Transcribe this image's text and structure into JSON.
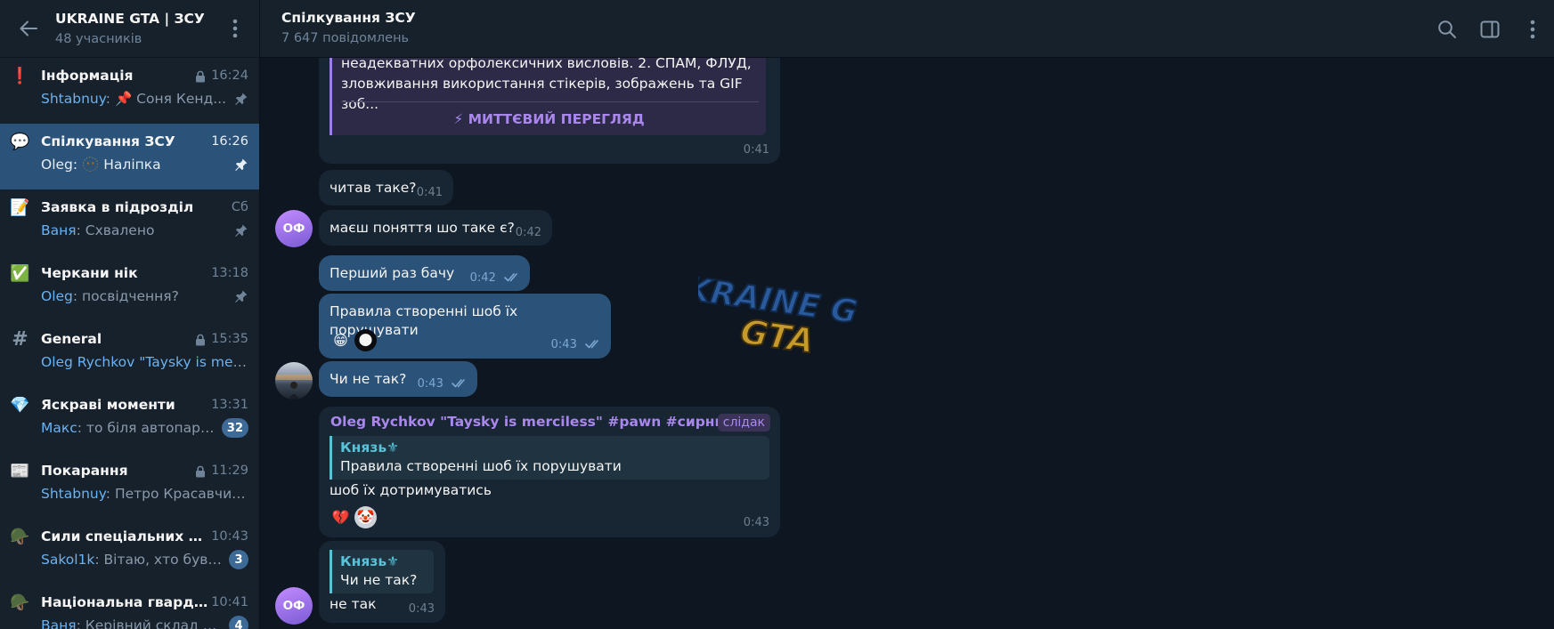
{
  "group": {
    "title": "UKRAINE GTA | ЗСУ",
    "members": "48 учасників"
  },
  "icons": {
    "back": "arrow-left-icon",
    "menu": "more-vertical-icon",
    "search": "search-icon",
    "sidebar_toggle": "side-panel-icon",
    "more": "more-vertical-icon",
    "lock": "lock-icon",
    "pin": "pin-icon",
    "read": "double-check-icon",
    "instant_view": "lightning-icon"
  },
  "colors": {
    "accent": "#2b5278",
    "link": "#6ab2f2",
    "badge": "#3e6a97",
    "forward_name": "#a987ec",
    "quote": "#58c2d9"
  },
  "topics": [
    {
      "icon": "❗",
      "name": "Інформація",
      "locked": true,
      "time": "16:24",
      "sender": "Shtabnuy",
      "preview": " 📌 Соня Кенд...",
      "pinned": true,
      "badge": "",
      "active": false
    },
    {
      "icon": "💬",
      "name": "Спілкування ЗСУ",
      "locked": false,
      "time": "16:26",
      "sender": "Oleg",
      "preview": " 🫥 Наліпка",
      "pinned": true,
      "badge": "",
      "active": true
    },
    {
      "icon": "📝",
      "name": "Заявка в підрозділ",
      "locked": false,
      "time": "Сб",
      "sender": "Ваня",
      "preview": " Схвалено",
      "pinned": true,
      "badge": "",
      "active": false
    },
    {
      "icon": "✅",
      "name": "Черкани нік",
      "locked": false,
      "time": "13:18",
      "sender": "Oleg",
      "preview": " посвідчення?",
      "pinned": true,
      "badge": "",
      "active": false
    },
    {
      "icon": "#",
      "name": "General",
      "locked": true,
      "time": "15:35",
      "sender": "Oleg Rychkov \"Taysky is merci...",
      "preview": "",
      "pinned": false,
      "badge": "",
      "active": false
    },
    {
      "icon": "💎",
      "name": "Яскраві моменти",
      "locked": false,
      "time": "13:31",
      "sender": "Макс",
      "preview": " то біля автопарку",
      "pinned": false,
      "badge": "32",
      "active": false
    },
    {
      "icon": "📰",
      "name": "Покарання",
      "locked": true,
      "time": "11:29",
      "sender": "Shtabnuy",
      "preview": " Петро Красавчик ...",
      "pinned": false,
      "badge": "",
      "active": false
    },
    {
      "icon": "🪖",
      "name": "Сили спеціальних оп...",
      "locked": false,
      "time": "10:43",
      "sender": "Sakol1k",
      "preview": " Вітаю, хто був у ...",
      "pinned": false,
      "badge": "3",
      "active": false
    },
    {
      "icon": "🪖",
      "name": "Національна гвардія ...",
      "locked": false,
      "time": "10:41",
      "sender": "Ваня",
      "preview": " Керівний склад НГ...",
      "pinned": false,
      "badge": "4",
      "active": false
    }
  ],
  "chat": {
    "title": "Спілкування ЗСУ",
    "count": "7 647 повідомлень",
    "watermark": "UKRAINE GTA",
    "avatar_initials": "ОФ",
    "messages": {
      "rules_preview": {
        "line1": "неадекватних орфолексичних висловів. 2. СПАМ, ФЛУД,",
        "line2": "зловживання використання стікерів, зображень та GIF зоб...",
        "button": "⚡ МИТТЄВИЙ ПЕРЕГЛЯД",
        "time": "0:41"
      },
      "m1": {
        "text": "читав таке?",
        "time": "0:41"
      },
      "m2": {
        "text": "маєш поняття шо таке є?",
        "time": "0:42"
      },
      "m3": {
        "text": "Перший раз бачу",
        "time": "0:42"
      },
      "m4": {
        "text": "Правила створенні шоб їх порушувати",
        "time": "0:43",
        "reactions": [
          "😁",
          "🌑"
        ]
      },
      "m5": {
        "text": "Чи не так?",
        "time": "0:43"
      },
      "m6": {
        "author": "Oleg Rychkov \"Taysky is merciless\" #pawn #сирник ...",
        "tag": "слідак",
        "quote_name": "Князь⚜",
        "quote_text": "Правила створенні шоб їх порушувати",
        "text": "шоб їх дотримуватись",
        "reactions": [
          "💔",
          "🤡"
        ],
        "time": "0:43"
      },
      "m7": {
        "quote_name": "Князь⚜",
        "quote_text": "Чи не так?",
        "text": "не так",
        "time": "0:43"
      }
    }
  }
}
